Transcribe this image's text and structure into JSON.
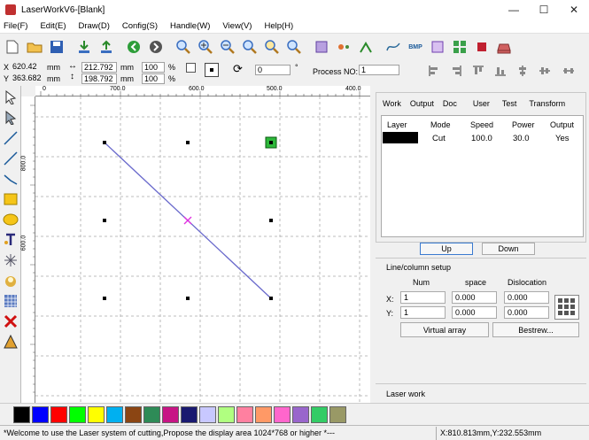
{
  "window": {
    "title": "LaserWorkV6-[Blank]",
    "min": "—",
    "max": "☐",
    "close": "✕"
  },
  "menu": [
    "File(F)",
    "Edit(E)",
    "Draw(D)",
    "Config(S)",
    "Handle(W)",
    "View(V)",
    "Help(H)"
  ],
  "toolbar": {
    "icons": [
      "new-file-icon",
      "open-folder-icon",
      "save-icon",
      "import-icon",
      "export-icon",
      "back-icon",
      "forward-icon",
      "zoom-in-icon",
      "zoom-plus-icon",
      "zoom-minus-icon",
      "zoom-fit-icon",
      "zoom-all-icon",
      "zoom-window-icon",
      "select-icon",
      "node-icon",
      "path-icon",
      "curve-icon",
      "bmp-icon",
      "grid-icon",
      "array-icon",
      "align-icon",
      "machine-icon"
    ],
    "bmp_label": "BMP"
  },
  "props": {
    "x_label": "X",
    "x_value": "620.42",
    "x_unit": "mm",
    "y_label": "Y",
    "y_value": "363.682",
    "y_unit": "mm",
    "w_value": "212.792",
    "w_unit": "mm",
    "h_value": "198.792",
    "h_unit": "mm",
    "sx_value": "100",
    "sx_unit": "%",
    "sy_value": "100",
    "sy_unit": "%",
    "rotate_value": "0",
    "degree": "°",
    "process_label": "Process NO:",
    "process_value": "1"
  },
  "ruler": {
    "top": [
      "0",
      "700.0",
      "600.0",
      "500.0",
      "400.0"
    ],
    "left": [
      "800.0",
      "600.0"
    ]
  },
  "tabs": [
    "Work",
    "Output",
    "Doc",
    "User",
    "Test",
    "Transform"
  ],
  "layer_table": {
    "headers": [
      "Layer",
      "Mode",
      "Speed",
      "Power",
      "Output"
    ],
    "row": {
      "color": "#000000",
      "mode": "Cut",
      "speed": "100.0",
      "power": "30.0",
      "output": "Yes"
    }
  },
  "buttons": {
    "up": "Up",
    "down": "Down",
    "virtual_array": "Virtual array",
    "bestrew": "Bestrew..."
  },
  "linecol": {
    "title": "Line/column setup",
    "num_h": "Num",
    "space_h": "space",
    "disloc_h": "Dislocation",
    "x_label": "X:",
    "y_label": "Y:",
    "x_num": "1",
    "x_space": "0.000",
    "x_disloc": "0.000",
    "y_num": "1",
    "y_space": "0.000",
    "y_disloc": "0.000"
  },
  "laser_work_label": "Laser work",
  "palette": [
    "#000000",
    "#0000ff",
    "#ff0000",
    "#00ff00",
    "#ffff00",
    "#00b0f0",
    "#8b4513",
    "#2e8b57",
    "#c71585",
    "#191970",
    "#c8c8ff",
    "#b0ff80",
    "#ff80a0",
    "#ff9966",
    "#ff66cc",
    "#9966cc",
    "#33cc66",
    "#999966"
  ],
  "status": {
    "message": "*Welcome to use the Laser system of cutting,Propose the display area 1024*768 or higher *---",
    "coords": "X:810.813mm,Y:232.553mm"
  }
}
